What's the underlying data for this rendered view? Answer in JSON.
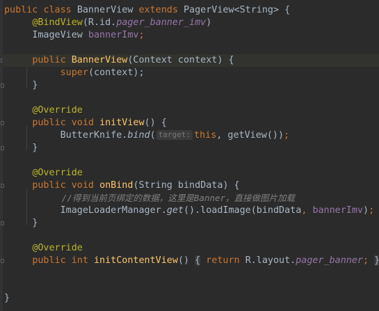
{
  "code": {
    "l1": {
      "kw1": "public",
      "kw2": "class",
      "name": "BannerView",
      "kw3": "extends",
      "parent": "PagerView<String> {"
    },
    "l2": {
      "ann": "@BindView",
      "args_a": "(R.id.",
      "args_b": "pager_banner_imv",
      "args_c": ")"
    },
    "l3": {
      "type": "ImageView ",
      "field": "bannerImv",
      "semi": ";"
    },
    "l4": {
      "kw": "public",
      "name": "BannerView",
      "params": "(Context context) {"
    },
    "l5": {
      "kw": "super",
      "rest": "(context);"
    },
    "l6": {
      "brace": "}"
    },
    "l7": {
      "ann": "@Override"
    },
    "l8": {
      "kw1": "public",
      "kw2": "void",
      "name": "initView",
      "rest": "() {"
    },
    "l9": {
      "cls": "ButterKnife.",
      "method": "bind",
      "open": "(",
      "hint": "target:",
      "kw": "this",
      "rest1": ", getView())",
      "semi": ";"
    },
    "l10": {
      "brace": "}"
    },
    "l11": {
      "ann": "@Override"
    },
    "l12": {
      "kw1": "public",
      "kw2": "void",
      "name": "onBind",
      "rest": "(String bindData) {"
    },
    "l13": {
      "comment": "//得到当前页绑定的数据，这里是Banner，直接做图片加载"
    },
    "l14": {
      "cls": "ImageLoaderManager.",
      "method": "get",
      "mid": "().loadImage(bindData",
      "comma": ", ",
      "field": "bannerImv",
      "end": ")",
      "semi": ";"
    },
    "l15": {
      "brace": "}"
    },
    "l16": {
      "ann": "@Override"
    },
    "l17": {
      "kw1": "public",
      "kw2": "int",
      "name": "initContentView",
      "paren": "()",
      "open": "{",
      "kw3": "return",
      "ref": "R.layout.",
      "field": "pager_banner",
      "semi": ";",
      "close": "}"
    },
    "l18": {
      "brace": "}"
    }
  },
  "colors": {
    "background": "#2b2b2b",
    "keyword": "#cc7832",
    "annotation": "#bbb529",
    "method_decl": "#ffc66d",
    "field": "#9876aa",
    "comment": "#808080",
    "text": "#a9b7c6"
  }
}
